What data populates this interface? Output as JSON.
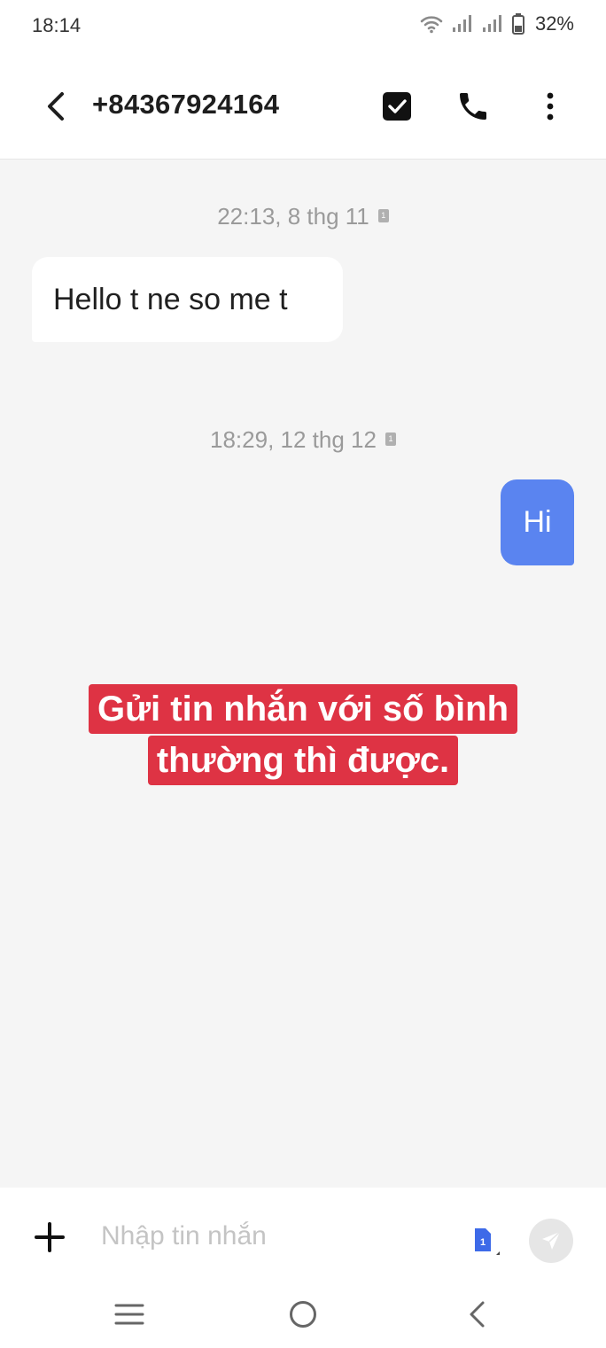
{
  "status_bar": {
    "time": "18:14",
    "battery_percent": "32%",
    "icons": [
      "wifi-icon",
      "signal-sim1-icon",
      "signal-sim2-icon",
      "battery-icon"
    ]
  },
  "app_bar": {
    "contact": "+84367924164",
    "icons": [
      "back-arrow-icon",
      "checkbox-icon",
      "phone-icon",
      "more-vertical-icon"
    ]
  },
  "conversation": {
    "messages": [
      {
        "timestamp": "22:13, 8 thg 11",
        "direction": "incoming",
        "text": "Hello t ne so me t",
        "sim": "1"
      },
      {
        "timestamp": "18:29, 12 thg 12",
        "direction": "outgoing",
        "text": "Hi",
        "sim": "1"
      }
    ]
  },
  "caption": {
    "line1": "Gửi tin nhắn với số bình",
    "line2": "thường thì được.",
    "color": "#de3344"
  },
  "compose": {
    "value": "",
    "placeholder": "Nhập tin nhắn",
    "sim_badge": "1",
    "icons": [
      "plus-icon",
      "sim-card-icon",
      "send-icon"
    ]
  },
  "nav_bar": {
    "icons": [
      "recents-icon",
      "home-icon",
      "nav-back-icon"
    ]
  },
  "colors": {
    "accent": "#5a84f0",
    "background": "#f5f5f5",
    "surface": "#ffffff"
  }
}
